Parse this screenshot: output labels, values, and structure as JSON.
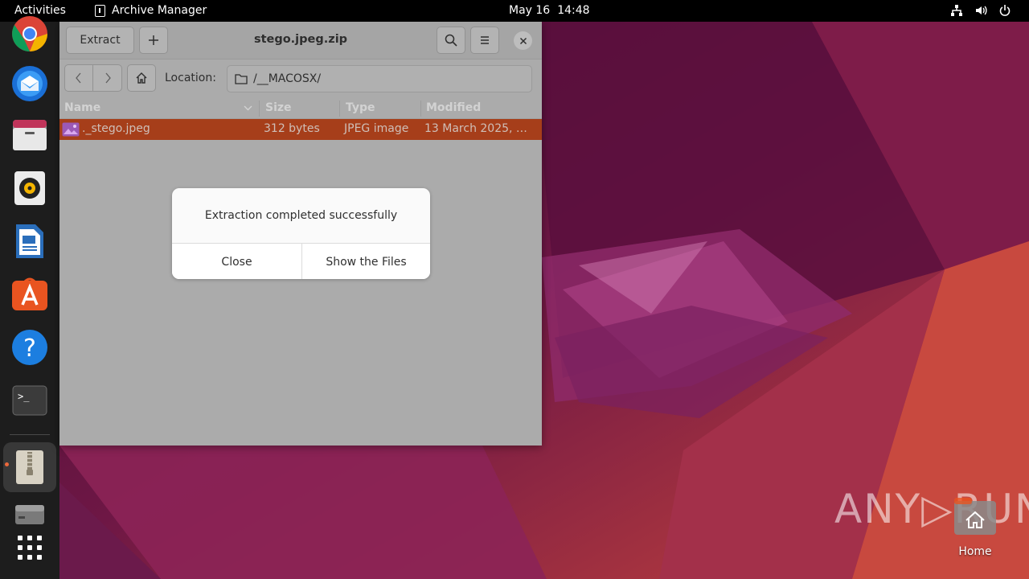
{
  "topbar": {
    "activities": "Activities",
    "app_name": "Archive Manager",
    "date": "May 16",
    "time": "14:48"
  },
  "dock": {
    "items": [
      "chrome-icon",
      "thunderbird-icon",
      "files-icon",
      "rhythmbox-icon",
      "libreoffice-writer-icon",
      "app-center-icon",
      "help-icon",
      "terminal-icon",
      "archive-manager-icon",
      "disk-icon",
      "show-apps-icon"
    ]
  },
  "window": {
    "extract_label": "Extract",
    "title": "stego.jpeg.zip",
    "location_label": "Location:",
    "location_value": "/__MACOSX/",
    "columns": [
      "Name",
      "Size",
      "Type",
      "Modified"
    ],
    "rows": [
      {
        "name": "._stego.jpeg",
        "size": "312 bytes",
        "type": "JPEG image",
        "modified": "13 March 2025, …"
      }
    ]
  },
  "dialog": {
    "message": "Extraction completed successfully",
    "close_label": "Close",
    "show_files_label": "Show the Files"
  },
  "desktop": {
    "watermark": "ANY▷RUN",
    "home_label": "Home"
  },
  "colors": {
    "accent": "#e95420",
    "selection": "#a63e1a"
  }
}
